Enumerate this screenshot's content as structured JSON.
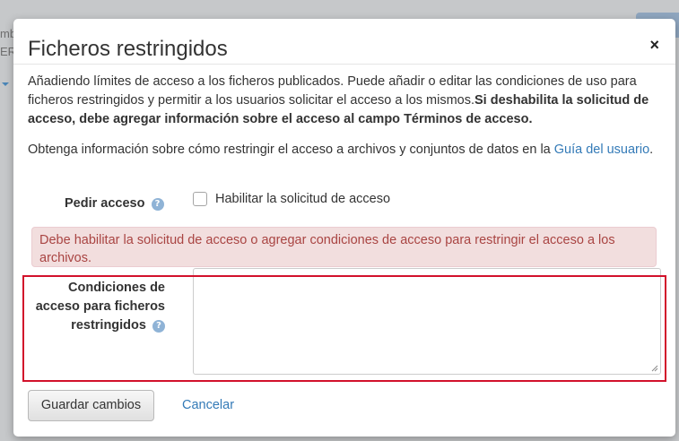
{
  "background": {
    "text_line1": "mb",
    "text_line2": "ERS"
  },
  "modal": {
    "title": "Ficheros restringidos",
    "close_symbol": "×",
    "intro_text": "Añadiendo límites de acceso a los ficheros publicados. Puede añadir o editar las condiciones de uso para ficheros restringidos y permitir a los usuarios solicitar el acceso a los mismos.",
    "intro_bold": "Si deshabilita la solicitud de acceso, debe agregar información sobre el acceso al campo Términos de acceso.",
    "info_text": "Obtenga información sobre cómo restringir el acceso a archivos y conjuntos de datos en la ",
    "info_link": "Guía del usuario",
    "info_end": ".",
    "request_access_label": "Pedir acceso",
    "help_icon": "?",
    "enable_request_label": "Habilitar la solicitud de acceso",
    "enable_request_checked": false,
    "alert_text": "Debe habilitar la solicitud de acceso o agregar condiciones de acceso para restringir el acceso a los archivos.",
    "conditions_label": "Condiciones de acceso para ficheros restringidos",
    "conditions_value": "",
    "save_button": "Guardar cambios",
    "cancel_button": "Cancelar"
  },
  "colors": {
    "alert_bg": "#f2dede",
    "alert_text": "#a94442",
    "link": "#337ab7",
    "highlight_border": "#d2112b"
  }
}
